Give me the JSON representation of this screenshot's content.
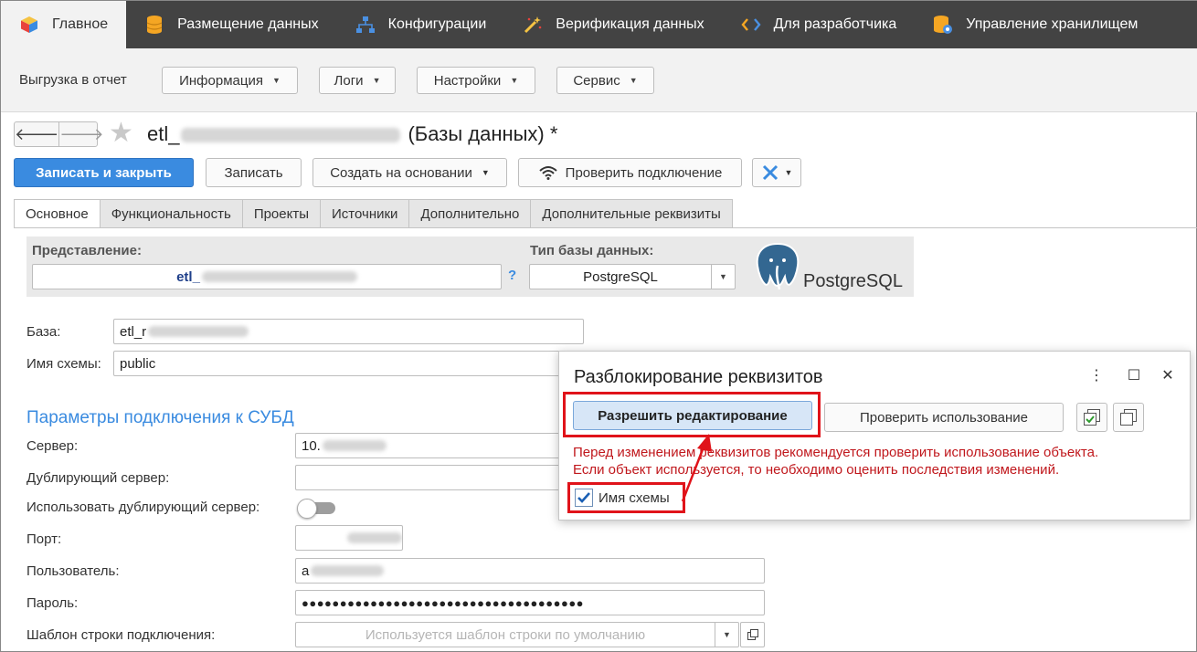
{
  "sections": [
    {
      "label": "Главное",
      "icon": "cube-icon",
      "active": true
    },
    {
      "label": "Размещение данных",
      "icon": "database-icon",
      "active": false
    },
    {
      "label": "Конфигурации",
      "icon": "hierarchy-icon",
      "active": false
    },
    {
      "label": "Верификация данных",
      "icon": "magic-wand-icon",
      "active": false
    },
    {
      "label": "Для разработчика",
      "icon": "code-icon",
      "active": false
    },
    {
      "label": "Управление хранилищем",
      "icon": "storage-gear-icon",
      "active": false
    }
  ],
  "subbar": {
    "export_label": "Выгрузка в отчет",
    "menus": [
      "Информация",
      "Логи",
      "Настройки",
      "Сервис"
    ]
  },
  "form": {
    "title_prefix": "etl_",
    "title_suffix": "(Базы данных) *",
    "buttons": {
      "save_close": "Записать и закрыть",
      "save": "Записать",
      "create_based": "Создать на основании",
      "check_connection": "Проверить подключение"
    },
    "tabs": [
      "Основное",
      "Функциональность",
      "Проекты",
      "Источники",
      "Дополнительно",
      "Дополнительные реквизиты"
    ],
    "presentation_label": "Представление:",
    "presentation_value": "etl_",
    "help": "?",
    "db_type_label": "Тип базы данных:",
    "db_type_value": "PostgreSQL",
    "logo_text": "PostgreSQL",
    "base_label": "База:",
    "base_value": "etl_r",
    "schema_label": "Имя схемы:",
    "schema_value": "public",
    "section_title": "Параметры подключения к СУБД",
    "server_label": "Сервер:",
    "server_value": "10.",
    "dup_server_label": "Дублирующий сервер:",
    "use_dup_label": "Использовать дублирующий сервер:",
    "port_label": "Порт:",
    "user_label": "Пользователь:",
    "user_value": "a",
    "password_label": "Пароль:",
    "password_value": "●●●●●●●●●●●●●●●●●●●●●●●●●●●●●●●●●●●●●",
    "template_label": "Шаблон строки подключения:",
    "template_placeholder": "Используется шаблон строки по умолчанию"
  },
  "dialog": {
    "title": "Разблокирование реквизитов",
    "allow_edit": "Разрешить редактирование",
    "check_usage": "Проверить использование",
    "warning_line1": "Перед изменением реквизитов рекомендуется проверить использование объекта.",
    "warning_line2": "Если объект используется, то необходимо оценить последствия изменений.",
    "checkbox_label": "Имя схемы",
    "more": "⋮",
    "maximize": "☐",
    "close": "✕"
  }
}
